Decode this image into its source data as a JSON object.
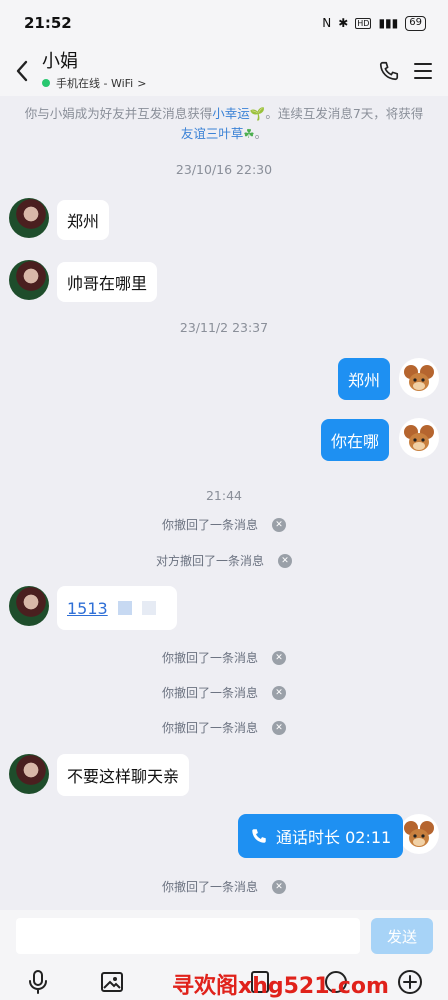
{
  "status_bar": {
    "time": "21:52",
    "battery": "69"
  },
  "header": {
    "title": "小娟",
    "presence": "手机在线 - WiFi",
    "presence_chevron": ">"
  },
  "notice": {
    "part1": "你与小娟成为好友并互发消息获得",
    "link1": "小幸运",
    "part2": "。连续互发消息7天，将获得",
    "link2": "友谊三叶草",
    "part3": "。"
  },
  "messages": {
    "ts1": "23/10/16 22:30",
    "m1": "郑州",
    "m2": "帅哥在哪里",
    "ts2": "23/11/2 23:37",
    "m3": "郑州",
    "m4": "你在哪",
    "ts3": "21:44",
    "r1": "你撤回了一条消息",
    "r2": "对方撤回了一条消息",
    "m5": "1513",
    "r3": "你撤回了一条消息",
    "r4": "你撤回了一条消息",
    "r5": "你撤回了一条消息",
    "m6": "不要这样聊天亲",
    "m7": "通话时长 02:11",
    "r6": "你撤回了一条消息"
  },
  "input": {
    "placeholder": "",
    "send_label": "发送"
  },
  "watermark": "寻欢阁xhg521.com",
  "icons": {
    "back": "back-arrow-icon",
    "call": "phone-icon",
    "menu": "menu-icon",
    "voice": "microphone-icon",
    "image": "image-icon",
    "plus": "plus-icon"
  },
  "colors": {
    "accent": "#1e90f2",
    "online": "#28c76f",
    "send_disabled": "#a7d3f7"
  }
}
